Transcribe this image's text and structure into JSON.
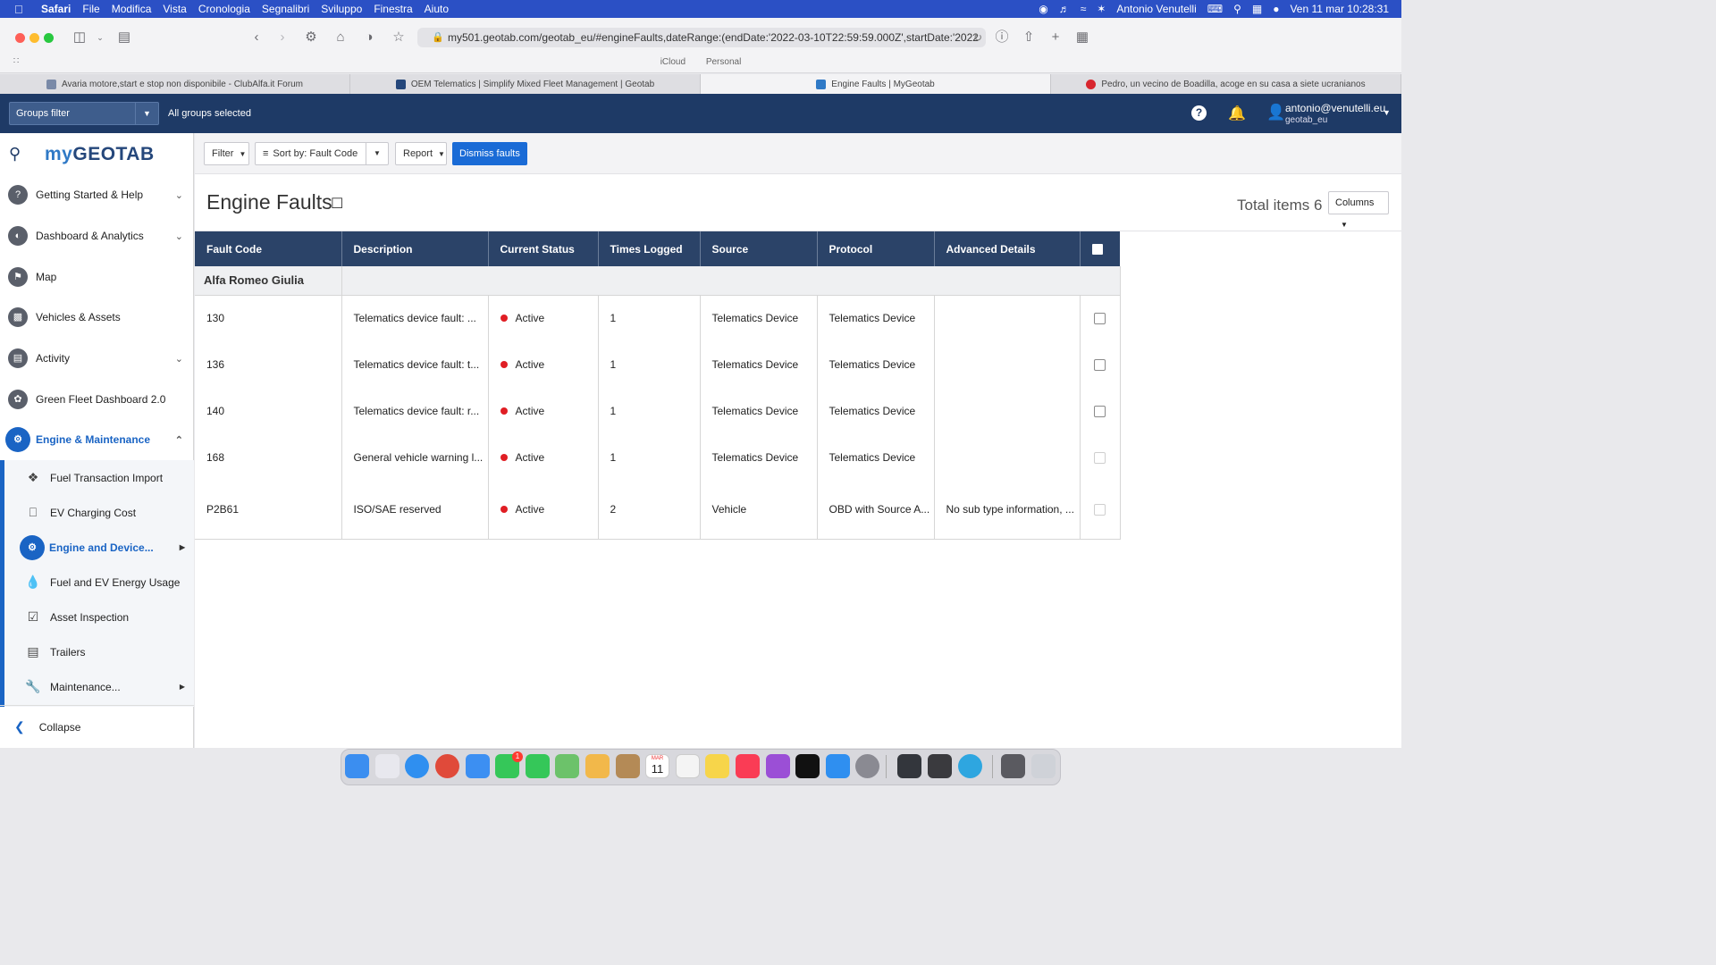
{
  "menubar": {
    "app_name": "Safari",
    "items": [
      "File",
      "Modifica",
      "Vista",
      "Cronologia",
      "Segnalibri",
      "Sviluppo",
      "Finestra",
      "Aiuto"
    ],
    "user": "Antonio Venutelli",
    "datetime": "Ven 11 mar  10:28:31"
  },
  "browser": {
    "url": "my501.geotab.com/geotab_eu/#engineFaults,dateRange:(endDate:'2022-03-10T22:59:59.000Z',startDate:'2022",
    "profile_left": "iCloud",
    "profile_right": "Personal",
    "tabs": [
      {
        "title": "Avaria motore,start e stop non disponibile - ClubAlfa.it Forum",
        "favicon_color": "#7a8aa8"
      },
      {
        "title": "OEM Telematics | Simplify Mixed Fleet Management | Geotab",
        "favicon_color": "#25477b"
      },
      {
        "title": "Engine Faults | MyGeotab",
        "favicon_color": "#2f79c6"
      },
      {
        "title": "Pedro, un vecino de Boadilla, acoge en su casa a siete ucranianos",
        "favicon_color": "#d8262e"
      }
    ]
  },
  "header": {
    "groups_filter": "Groups filter",
    "all_groups": "All groups selected",
    "user_email": "antonio@venutelli.eu",
    "user_database": "geotab_eu"
  },
  "sidebar": {
    "logo_prefix": "my",
    "logo_main": "GEOTAB",
    "nav_items": [
      {
        "label": "Getting Started & Help",
        "icon": "help-icon"
      },
      {
        "label": "Dashboard & Analytics",
        "icon": "dashboard-icon"
      },
      {
        "label": "Map",
        "icon": "map-icon"
      },
      {
        "label": "Vehicles & Assets",
        "icon": "truck-icon"
      },
      {
        "label": "Activity",
        "icon": "chart-icon"
      },
      {
        "label": "Green Fleet Dashboard 2.0",
        "icon": "leaf-icon"
      },
      {
        "label": "Engine & Maintenance",
        "icon": "engine-icon"
      }
    ],
    "sub_items": [
      {
        "label": "Fuel Transaction Import",
        "icon": "puzzle-icon"
      },
      {
        "label": "EV Charging Cost",
        "icon": "ev-charger-icon"
      },
      {
        "label": "Engine and Device...",
        "icon": "engine-icon"
      },
      {
        "label": "Fuel and EV Energy Usage",
        "icon": "fuel-drop-icon"
      },
      {
        "label": "Asset Inspection",
        "icon": "clipboard-icon"
      },
      {
        "label": "Trailers",
        "icon": "trailer-icon"
      },
      {
        "label": "Maintenance...",
        "icon": "wrench-icon"
      }
    ],
    "collapse": "Collapse"
  },
  "toolbar": {
    "filter": "Filter",
    "sort_by": "Sort by:",
    "sort_value": "Fault Code",
    "report": "Report",
    "dismiss": "Dismiss faults"
  },
  "page": {
    "title": "Engine Faults",
    "total_items": "Total items 6",
    "columns": "Columns"
  },
  "table": {
    "headers": [
      "Fault Code",
      "Description",
      "Current Status",
      "Times Logged",
      "Source",
      "Protocol",
      "Advanced Details"
    ],
    "group": "Alfa Romeo Giulia",
    "rows": [
      {
        "code": "130",
        "description": "Telematics device fault: ...",
        "status": "Active",
        "times": "1",
        "source": "Telematics Device",
        "protocol": "Telematics Device",
        "details": ""
      },
      {
        "code": "136",
        "description": "Telematics device fault: t...",
        "status": "Active",
        "times": "1",
        "source": "Telematics Device",
        "protocol": "Telematics Device",
        "details": ""
      },
      {
        "code": "140",
        "description": "Telematics device fault: r...",
        "status": "Active",
        "times": "1",
        "source": "Telematics Device",
        "protocol": "Telematics Device",
        "details": ""
      },
      {
        "code": "168",
        "description": "General vehicle warning l...",
        "status": "Active",
        "times": "1",
        "source": "Telematics Device",
        "protocol": "Telematics Device",
        "details": ""
      },
      {
        "code": "P2B61",
        "description": "ISO/SAE reserved",
        "status": "Active",
        "times": "2",
        "source": "Vehicle",
        "protocol": "OBD with Source A...",
        "details": "No sub type information, ..."
      }
    ]
  },
  "colors": {
    "menubar": "#2b50c5",
    "header": "#1e3a66",
    "table_header": "#2b4368",
    "accent": "#1a64c4",
    "status_active": "#e01e24",
    "dismiss_button": "#1a6bd6"
  },
  "dock": {
    "apps": [
      {
        "name": "finder-icon",
        "color": "#3b8ef0"
      },
      {
        "name": "launchpad-icon",
        "color": "#e8e8ee"
      },
      {
        "name": "safari-icon",
        "color": "#2f8ff0"
      },
      {
        "name": "chrome-icon",
        "color": "#e04a3a"
      },
      {
        "name": "mail-icon",
        "color": "#3c8ff2"
      },
      {
        "name": "facetime-icon",
        "color": "#35c759"
      },
      {
        "name": "messages-icon",
        "color": "#35c759"
      },
      {
        "name": "maps-icon",
        "color": "#6cc26a"
      },
      {
        "name": "photos-icon",
        "color": "#f2b84a"
      },
      {
        "name": "notes-icon",
        "color": "#b48a56"
      },
      {
        "name": "calendar-icon",
        "color": "#ffffff"
      },
      {
        "name": "reminders-icon",
        "color": "#f4f4f4"
      },
      {
        "name": "stickies-icon",
        "color": "#f7d54a"
      },
      {
        "name": "music-icon",
        "color": "#fa3c55"
      },
      {
        "name": "podcasts-icon",
        "color": "#9b4fd6"
      },
      {
        "name": "appletv-icon",
        "color": "#111111"
      },
      {
        "name": "appstore-icon",
        "color": "#2f8ff0"
      },
      {
        "name": "system-preferences-icon",
        "color": "#8a8a92"
      },
      {
        "name": "quicktime-icon",
        "color": "#33363c"
      },
      {
        "name": "calculator-icon",
        "color": "#3a3a3e"
      },
      {
        "name": "telegram-icon",
        "color": "#2ea6e0"
      },
      {
        "name": "screenshot-icon",
        "color": "#5a5a60"
      },
      {
        "name": "trash-icon",
        "color": "#cfd2d8"
      }
    ],
    "facetime_badge": "1",
    "calendar_month": "MAR",
    "calendar_day": "11"
  }
}
